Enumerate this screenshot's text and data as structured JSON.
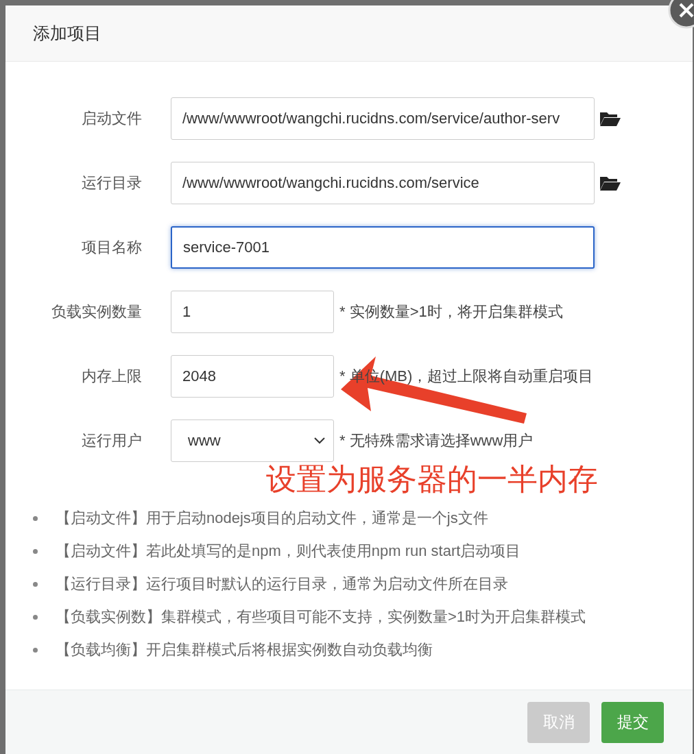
{
  "dialog": {
    "title": "添加项目"
  },
  "fields": [
    {
      "kind": "path",
      "label": "启动文件",
      "value": "/www/wwwroot/wangchi.rucidns.com/service/author-serv",
      "focused": false
    },
    {
      "kind": "path",
      "label": "运行目录",
      "value": "/www/wwwroot/wangchi.rucidns.com/service",
      "focused": false
    },
    {
      "kind": "text",
      "label": "项目名称",
      "value": "service-7001",
      "focused": true
    },
    {
      "kind": "short",
      "label": "负载实例数量",
      "value": "1",
      "hint": "* 实例数量>1时，将开启集群模式",
      "focused": false
    },
    {
      "kind": "short",
      "label": "内存上限",
      "value": "2048",
      "hint": "* 单位(MB)，超过上限将自动重启项目",
      "focused": false
    },
    {
      "kind": "select",
      "label": "运行用户",
      "value": "www",
      "hint": "* 无特殊需求请选择www用户",
      "focused": false
    }
  ],
  "annotation": {
    "text": "设置为服务器的一半内存"
  },
  "notes": [
    "【启动文件】用于启动nodejs项目的启动文件，通常是一个js文件",
    "【启动文件】若此处填写的是npm，则代表使用npm run start启动项目",
    "【运行目录】运行项目时默认的运行目录，通常为启动文件所在目录",
    "【负载实例数】集群模式，有些项目可能不支持，实例数量>1时为开启集群模式",
    "【负载均衡】开启集群模式后将根据实例数自动负载均衡"
  ],
  "buttons": [
    {
      "label": "取消",
      "kind": "secondary"
    },
    {
      "label": "提交",
      "kind": "primary"
    }
  ]
}
